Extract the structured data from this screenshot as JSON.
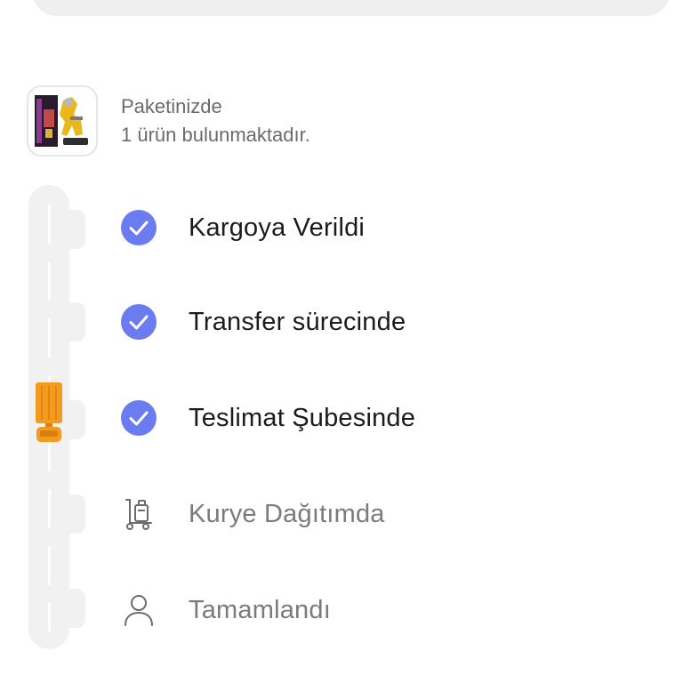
{
  "package": {
    "line1": "Paketinizde",
    "line2": "1 ürün bulunmaktadır."
  },
  "steps": [
    {
      "label": "Kargoya Verildi",
      "status": "done",
      "icon": "check-circle-icon"
    },
    {
      "label": "Transfer sürecinde",
      "status": "done",
      "icon": "check-circle-icon"
    },
    {
      "label": "Teslimat Şubesinde",
      "status": "done",
      "icon": "check-circle-icon"
    },
    {
      "label": "Kurye Dağıtımda",
      "status": "pending",
      "icon": "hand-truck-icon"
    },
    {
      "label": "Tamamlandı",
      "status": "pending",
      "icon": "person-icon"
    }
  ],
  "colors": {
    "check": "#6b7cf0",
    "truck": "#f39a1f",
    "track": "#f1f1f1"
  }
}
